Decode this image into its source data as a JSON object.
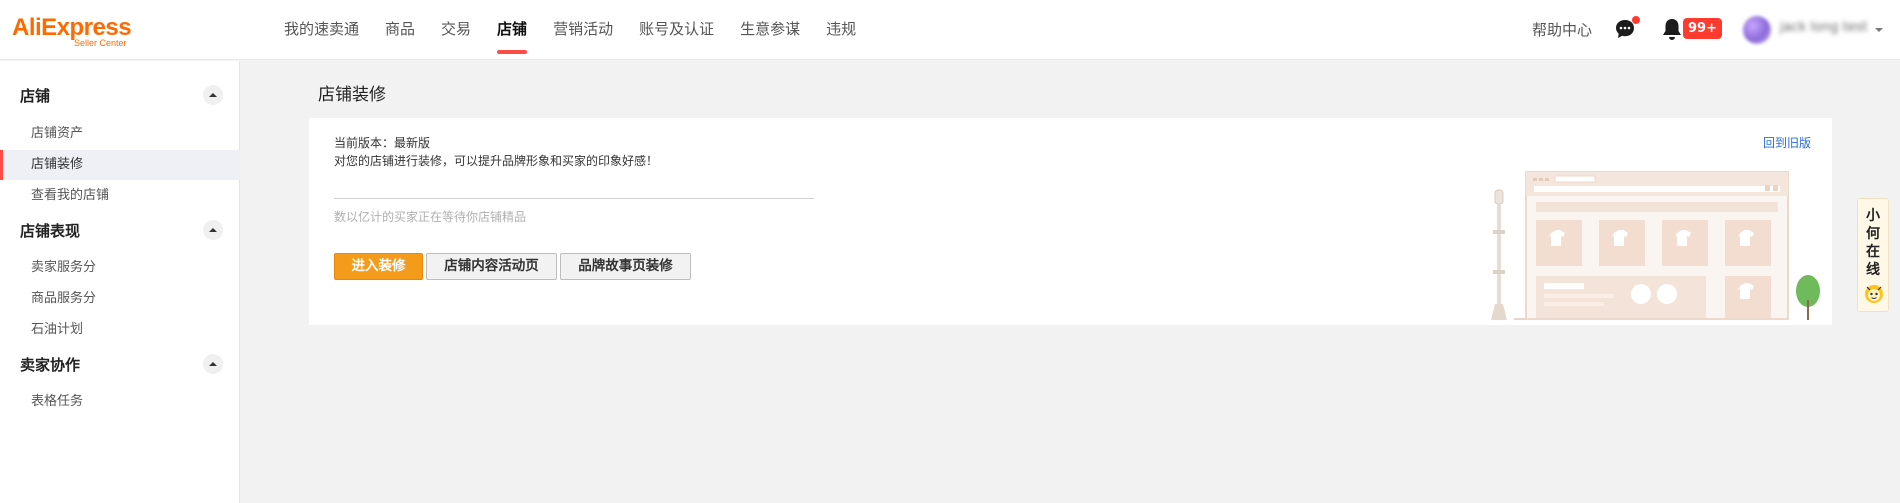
{
  "logo": {
    "brand": "AliExpress",
    "sub": "Seller Center"
  },
  "nav": {
    "items": [
      {
        "label": "我的速卖通"
      },
      {
        "label": "商品"
      },
      {
        "label": "交易"
      },
      {
        "label": "店铺"
      },
      {
        "label": "营销活动"
      },
      {
        "label": "账号及认证"
      },
      {
        "label": "生意参谋"
      },
      {
        "label": "违规"
      }
    ],
    "active": "店铺"
  },
  "header": {
    "help": "帮助中心",
    "notif_badge": "99+",
    "username": "jack long test"
  },
  "sidebar": {
    "sections": [
      {
        "title": "店铺",
        "items": [
          "店铺资产",
          "店铺装修",
          "查看我的店铺"
        ]
      },
      {
        "title": "店铺表现",
        "items": [
          "卖家服务分",
          "商品服务分",
          "石油计划"
        ]
      },
      {
        "title": "卖家协作",
        "items": [
          "表格任务"
        ]
      }
    ],
    "active_item": "店铺装修"
  },
  "main": {
    "title": "店铺装修",
    "version_text": "当前版本：最新版",
    "desc": "对您的店铺进行装修，可以提升品牌形象和买家的印象好感！",
    "hint": "数以亿计的买家正在等待你店铺精品",
    "buttons": {
      "enter": "进入装修",
      "activity": "店铺内容活动页",
      "brand": "品牌故事页装修"
    },
    "back_link": "回到旧版"
  },
  "helper": {
    "text": "小何在线"
  },
  "colors": {
    "accent": "#ff4c45",
    "brand": "#ff6a00",
    "primary_button": "#f59b1c",
    "link": "#2a6fd6"
  }
}
